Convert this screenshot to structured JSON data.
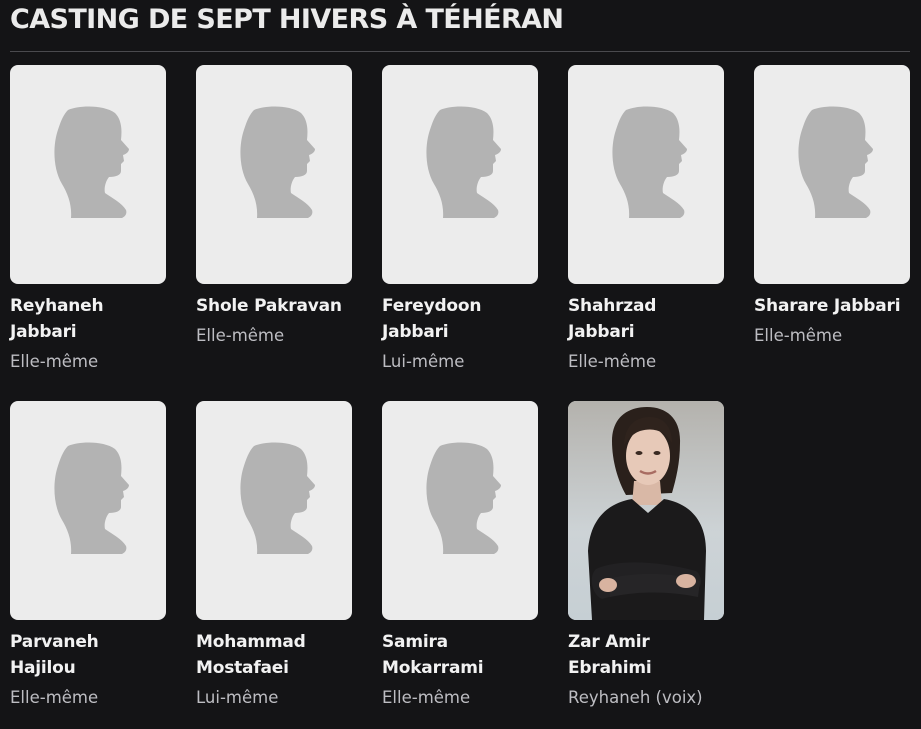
{
  "page": {
    "title": "CASTING DE SEPT HIVERS À TÉHÉRAN"
  },
  "colors": {
    "background": "#141416",
    "placeholder_bg": "#ececec",
    "silhouette": "#b3b3b3",
    "name_text": "#f2f2f2",
    "role_text": "#bdbdc2"
  },
  "cast": [
    {
      "name": "Reyhaneh Jabbari",
      "role": "Elle-même",
      "image": "profile-placeholder-icon"
    },
    {
      "name": "Shole Pakravan",
      "role": "Elle-même",
      "image": "profile-placeholder-icon"
    },
    {
      "name": "Fereydoon Jabbari",
      "role": "Lui-même",
      "image": "profile-placeholder-icon"
    },
    {
      "name": "Shahrzad Jabbari",
      "role": "Elle-même",
      "image": "profile-placeholder-icon"
    },
    {
      "name": "Sharare Jabbari",
      "role": "Elle-même",
      "image": "profile-placeholder-icon"
    },
    {
      "name": "Parvaneh Hajilou",
      "role": "Elle-même",
      "image": "profile-placeholder-icon"
    },
    {
      "name": "Mohammad Mostafaei",
      "role": "Lui-même",
      "image": "profile-placeholder-icon"
    },
    {
      "name": "Samira Mokarrami",
      "role": "Elle-même",
      "image": "profile-placeholder-icon"
    },
    {
      "name": "Zar Amir Ebrahimi",
      "role": "Reyhaneh (voix)",
      "image": "actor-photo"
    }
  ]
}
